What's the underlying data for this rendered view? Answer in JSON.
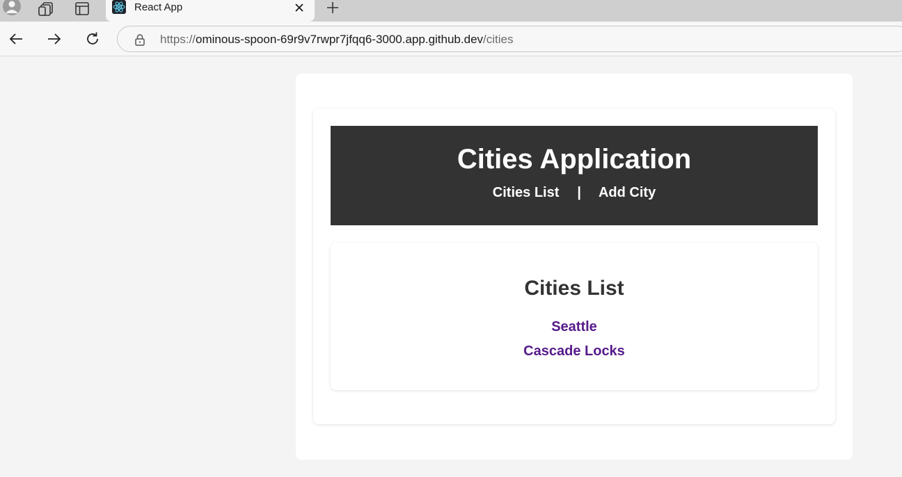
{
  "browser": {
    "tab": {
      "title": "React App"
    },
    "address_bar": {
      "scheme": "https://",
      "host": "ominous-spoon-69r9v7rwpr7jfqq6-3000.app.github.dev",
      "path": "/cities"
    },
    "icons": {
      "profile": "profile-icon",
      "workspaces": "workspaces-icon",
      "tab_actions": "tab-actions-icon",
      "favicon": "react-logo-icon",
      "close_tab": "close-icon",
      "new_tab": "plus-icon",
      "back": "back-arrow-icon",
      "forward": "forward-arrow-icon",
      "reload": "reload-icon",
      "lock": "lock-icon"
    }
  },
  "app": {
    "title": "Cities Application",
    "nav": {
      "cities_list": "Cities List",
      "separator": "|",
      "add_city": "Add City"
    },
    "list": {
      "heading": "Cities List",
      "cities": [
        {
          "name": "Seattle"
        },
        {
          "name": "Cascade Locks"
        }
      ]
    }
  },
  "colors": {
    "header_bg": "#333333",
    "header_text": "#ffffff",
    "page_bg": "#f4f4f4",
    "link_visited": "#551a8b",
    "heading_text": "#333333"
  }
}
